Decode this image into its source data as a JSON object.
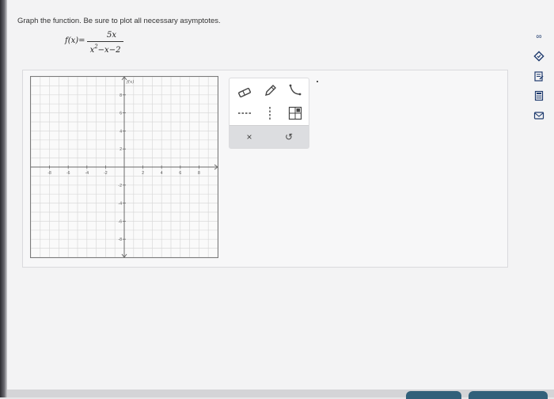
{
  "question": {
    "prompt": "Graph the function. Be sure to plot all necessary asymptotes.",
    "formula_lhs": "f(x)=",
    "numerator": "5x",
    "denominator_main": "x",
    "denominator_exp": "2",
    "denominator_rest": "−x−2"
  },
  "graph": {
    "y_axis_label": "f(x)",
    "x_ticks": [
      "-8",
      "-6",
      "-4",
      "-2",
      "2",
      "4",
      "6",
      "8"
    ],
    "y_ticks": [
      "8",
      "6",
      "4",
      "2",
      "-2",
      "-4",
      "-6",
      "-8"
    ],
    "x_range": [
      -10,
      10
    ],
    "y_range": [
      -10,
      10
    ],
    "grid": true
  },
  "toolbar": {
    "tools": [
      "eraser-tool",
      "pencil-tool",
      "curve-tool",
      "dashed-line-tool",
      "vertical-asymptote-tool",
      "quadrant-tool"
    ],
    "clear_label": "×",
    "undo_label": "↺"
  },
  "side_icons": {
    "infinity": "∞"
  },
  "colors": {
    "accent": "#1f3b6e",
    "grid": "#d9d9d9",
    "axis": "#6a6a6a"
  }
}
